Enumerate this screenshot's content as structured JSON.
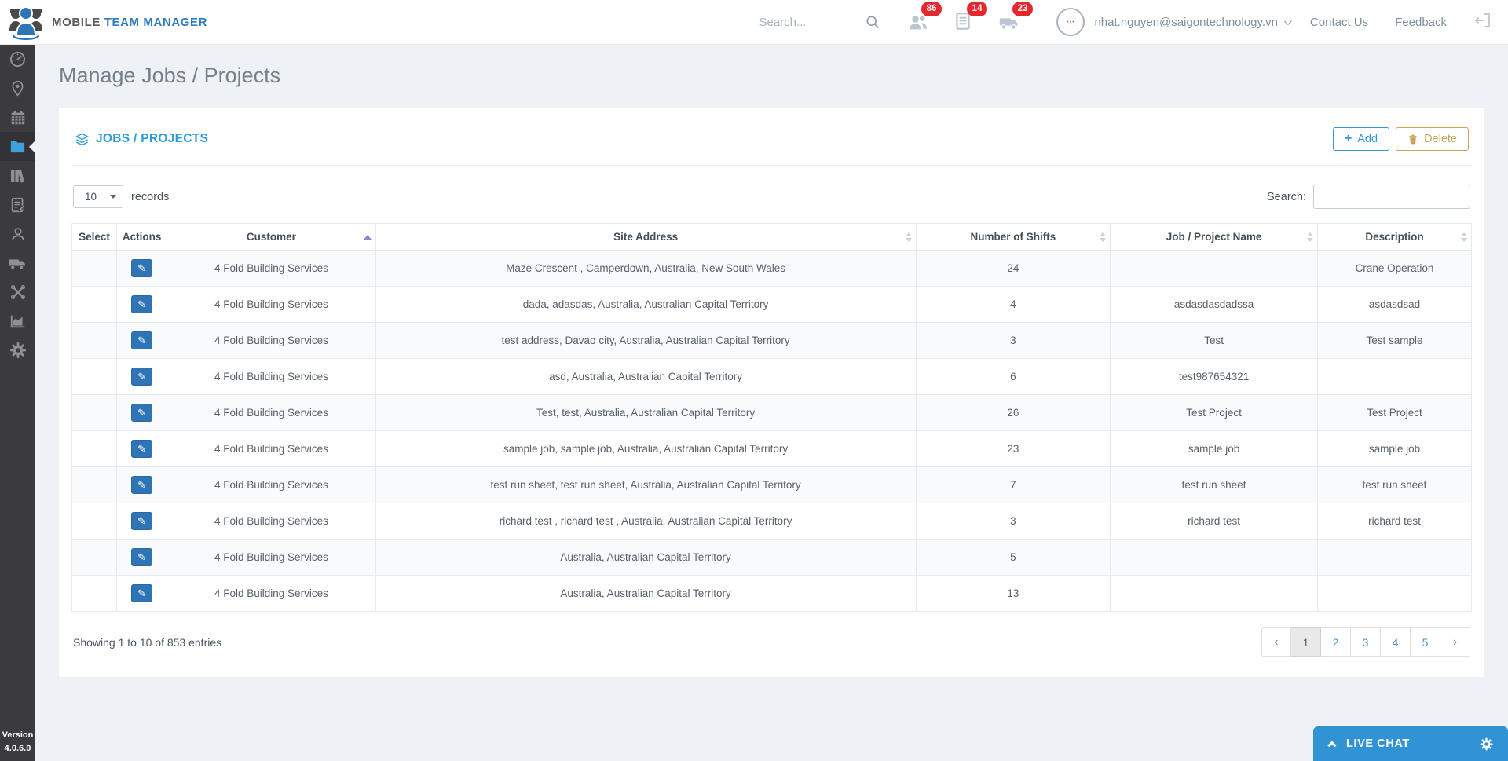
{
  "header": {
    "brand_bold": "MOBILE",
    "brand_accent": "TEAM MANAGER",
    "search_placeholder": "Search...",
    "notifications": [
      {
        "icon": "crew-icon",
        "count": "86"
      },
      {
        "icon": "runsheet-icon",
        "count": "14"
      },
      {
        "icon": "vehicle-icon",
        "count": "23"
      }
    ],
    "user_email": "nhat.nguyen@saigontechnology.vn",
    "contact_label": "Contact Us",
    "feedback_label": "Feedback"
  },
  "sidebar": {
    "items": [
      {
        "name": "dashboard",
        "active": false
      },
      {
        "name": "locations",
        "active": false
      },
      {
        "name": "calendar",
        "active": false
      },
      {
        "name": "jobs-projects",
        "active": true
      },
      {
        "name": "library",
        "active": false
      },
      {
        "name": "run-sheets",
        "active": false
      },
      {
        "name": "staff",
        "active": false
      },
      {
        "name": "vehicles",
        "active": false
      },
      {
        "name": "tools",
        "active": false
      },
      {
        "name": "reports",
        "active": false
      },
      {
        "name": "settings",
        "active": false
      }
    ],
    "version_label": "Version",
    "version_value": "4.0.6.0"
  },
  "page": {
    "title": "Manage Jobs / Projects"
  },
  "panel": {
    "title": "JOBS / PROJECTS",
    "add_label": "Add",
    "delete_label": "Delete",
    "records_value": "10",
    "records_label": "records",
    "search_label": "Search:",
    "table": {
      "edit_icon": "✎",
      "columns": [
        {
          "label": "Select",
          "sort": "none"
        },
        {
          "label": "Actions",
          "sort": "none"
        },
        {
          "label": "Customer",
          "sort": "asc"
        },
        {
          "label": "Site Address",
          "sort": "both"
        },
        {
          "label": "Number of Shifts",
          "sort": "both"
        },
        {
          "label": "Job / Project Name",
          "sort": "both"
        },
        {
          "label": "Description",
          "sort": "both"
        }
      ],
      "rows": [
        {
          "customer": "4 Fold Building Services",
          "site_address": "Maze Crescent , Camperdown, Australia, New South Wales",
          "shifts": "24",
          "job_name": "",
          "description": "Crane Operation"
        },
        {
          "customer": "4 Fold Building Services",
          "site_address": "dada, adasdas, Australia, Australian Capital Territory",
          "shifts": "4",
          "job_name": "asdasdasdadssa",
          "description": "asdasdsad"
        },
        {
          "customer": "4 Fold Building Services",
          "site_address": "test address, Davao city, Australia, Australian Capital Territory",
          "shifts": "3",
          "job_name": "Test",
          "description": "Test sample"
        },
        {
          "customer": "4 Fold Building Services",
          "site_address": "asd, Australia, Australian Capital Territory",
          "shifts": "6",
          "job_name": "test987654321",
          "description": ""
        },
        {
          "customer": "4 Fold Building Services",
          "site_address": "Test, test, Australia, Australian Capital Territory",
          "shifts": "26",
          "job_name": "Test Project",
          "description": "Test Project"
        },
        {
          "customer": "4 Fold Building Services",
          "site_address": "sample job, sample job, Australia, Australian Capital Territory",
          "shifts": "23",
          "job_name": "sample job",
          "description": "sample job"
        },
        {
          "customer": "4 Fold Building Services",
          "site_address": "test run sheet, test run sheet, Australia, Australian Capital Territory",
          "shifts": "7",
          "job_name": "test run sheet",
          "description": "test run sheet"
        },
        {
          "customer": "4 Fold Building Services",
          "site_address": "richard test , richard test , Australia, Australian Capital Territory",
          "shifts": "3",
          "job_name": "richard test",
          "description": "richard test"
        },
        {
          "customer": "4 Fold Building Services",
          "site_address": "Australia, Australian Capital Territory",
          "shifts": "5",
          "job_name": "",
          "description": ""
        },
        {
          "customer": "4 Fold Building Services",
          "site_address": "Australia, Australian Capital Territory",
          "shifts": "13",
          "job_name": "",
          "description": ""
        }
      ]
    },
    "footer": {
      "showing": "Showing 1 to 10 of 853 entries",
      "prev": "‹",
      "next": "›",
      "pages": [
        "1",
        "2",
        "3",
        "4",
        "5"
      ],
      "active_page": "1"
    }
  },
  "livechat": {
    "label": "LIVE CHAT"
  },
  "colors": {
    "brand_blue": "#2e7bbf",
    "panel_blue": "#2f9bd7",
    "badge_red": "#e4282e",
    "delete_tan": "#c9a45b",
    "edit_button_blue": "#2f74b4",
    "livechat_blue": "#3193d3",
    "sidebar_bg": "#3b3b3d",
    "active_icon_blue": "#3fa0dc"
  }
}
